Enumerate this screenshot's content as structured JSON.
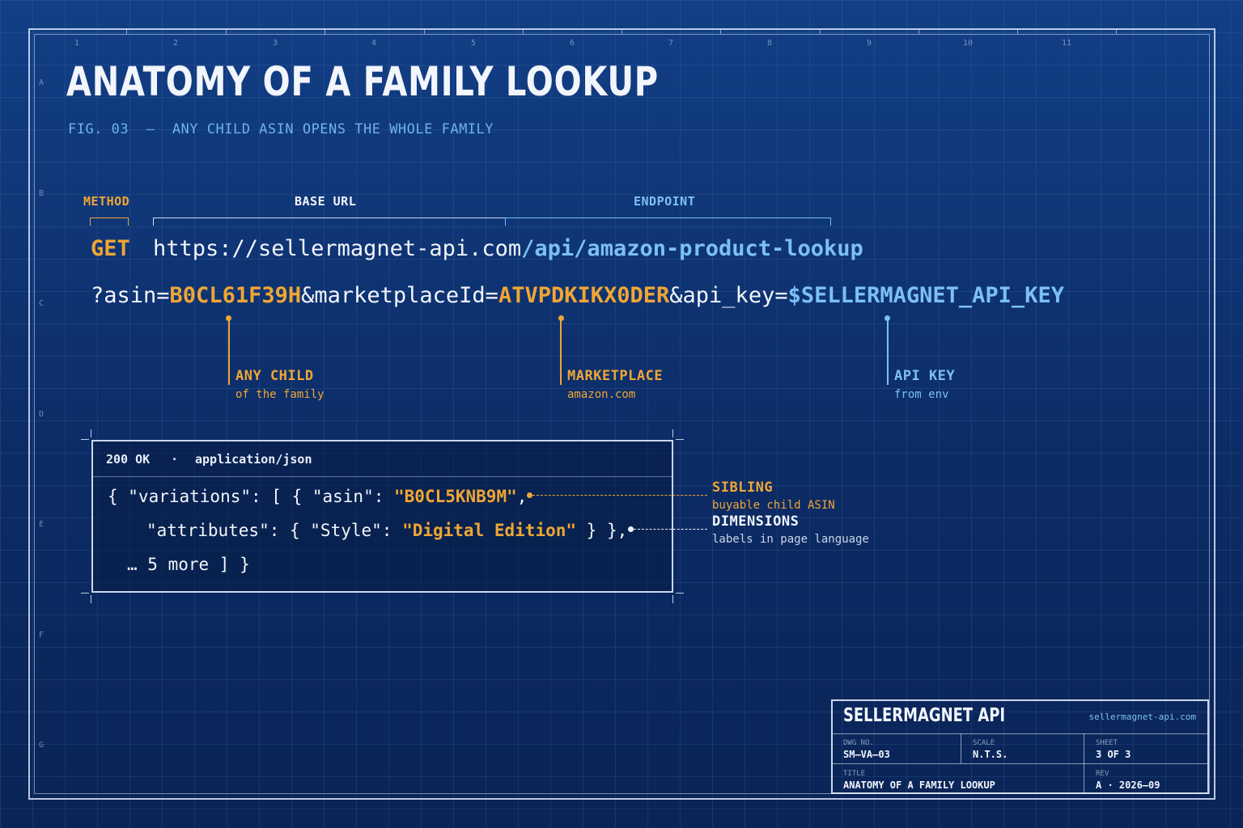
{
  "grid": {
    "columns": [
      "1",
      "2",
      "3",
      "4",
      "5",
      "6",
      "7",
      "8",
      "9",
      "10",
      "11"
    ],
    "rows": [
      "A",
      "B",
      "C",
      "D",
      "E",
      "F",
      "G"
    ]
  },
  "title": "ANATOMY OF A FAMILY LOOKUP",
  "subtitle": "FIG. 03  —  ANY CHILD ASIN OPENS THE WHOLE FAMILY",
  "request": {
    "labels": {
      "method": "METHOD",
      "base_url": "BASE URL",
      "endpoint": "ENDPOINT"
    },
    "method": "GET",
    "base_url": "https://sellermagnet-api.com",
    "endpoint": "/api/amazon-product-lookup",
    "query": {
      "asin_key": "?asin=",
      "asin_value": "B0CL61F39H",
      "marketplace_key": "&marketplaceId=",
      "marketplace_value": "ATVPDKIKX0DER",
      "api_key_key": "&api_key=",
      "api_key_value": "$SELLERMAGNET_API_KEY"
    }
  },
  "callouts": {
    "any_child": {
      "title": "ANY CHILD",
      "sub": "of the family"
    },
    "marketplace": {
      "title": "MARKETPLACE",
      "sub": "amazon.com"
    },
    "api_key": {
      "title": "API KEY",
      "sub": "from env"
    },
    "sibling": {
      "title": "SIBLING",
      "sub": "buyable child ASIN"
    },
    "dimensions": {
      "title": "DIMENSIONS",
      "sub": "labels in page language"
    }
  },
  "response": {
    "status": "200 OK",
    "separator": "·",
    "content_type": "application/json",
    "line1_prefix": "{ \"variations\": [ { \"asin\": ",
    "line1_value": "\"B0CL5KNB9M\"",
    "line1_suffix": ",",
    "line2_prefix": "\"attributes\": { \"Style\": ",
    "line2_value": "\"Digital Edition\"",
    "line2_suffix": " } },",
    "line3": "… 5 more ] }"
  },
  "title_block": {
    "brand": "SELLERMAGNET API",
    "url": "sellermagnet-api.com",
    "dwg_no_label": "DWG NO.",
    "dwg_no": "SM–VA–03",
    "scale_label": "SCALE",
    "scale": "N.T.S.",
    "sheet_label": "SHEET",
    "sheet": "3 OF 3",
    "title_label": "TITLE",
    "title": "ANATOMY OF A FAMILY LOOKUP",
    "rev_label": "REV",
    "rev": "A · 2026–09"
  },
  "colors": {
    "background": "#0d2d66",
    "accent_orange": "#f0a634",
    "accent_blue": "#7cc0f5",
    "ink": "#f2f5fb"
  }
}
